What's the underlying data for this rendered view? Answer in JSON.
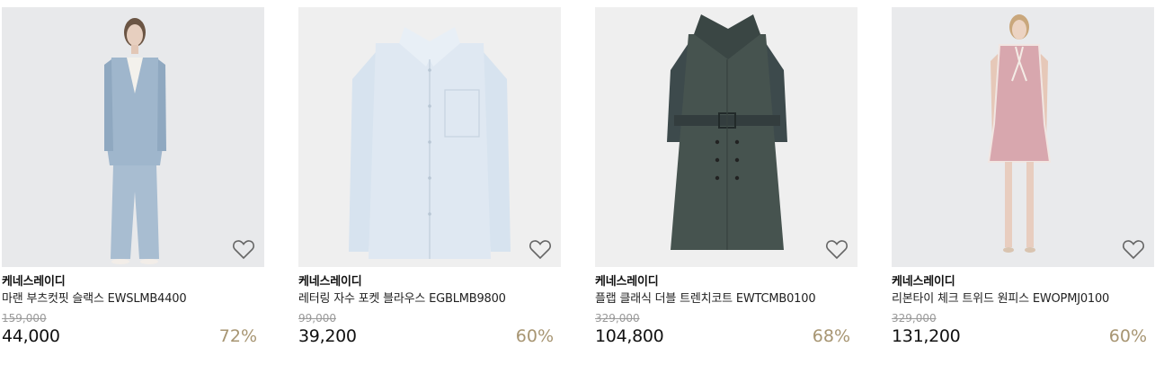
{
  "products": [
    {
      "brand": "케네스레이디",
      "name": "마랜 부츠컷핏 슬랙스 EWSLMB4400",
      "original_price": "159,000",
      "price": "44,000",
      "discount": "72%",
      "wishlist_icon": "heart-outline-icon"
    },
    {
      "brand": "케네스레이디",
      "name": "레터링 자수 포켓 블라우스 EGBLMB9800",
      "original_price": "99,000",
      "price": "39,200",
      "discount": "60%",
      "wishlist_icon": "heart-outline-icon"
    },
    {
      "brand": "케네스레이디",
      "name": "플랩 클래식 더블 트렌치코트 EWTCMB0100",
      "original_price": "329,000",
      "price": "104,800",
      "discount": "68%",
      "wishlist_icon": "heart-outline-icon"
    },
    {
      "brand": "케네스레이디",
      "name": "리본타이 체크 트위드 원피스 EWOPMJ0100",
      "original_price": "329,000",
      "price": "131,200",
      "discount": "60%",
      "wishlist_icon": "heart-outline-icon"
    }
  ],
  "colors": {
    "discount": "#a79572",
    "original_price": "#9a9a9a",
    "thumb_bg": "#e9eaec"
  }
}
